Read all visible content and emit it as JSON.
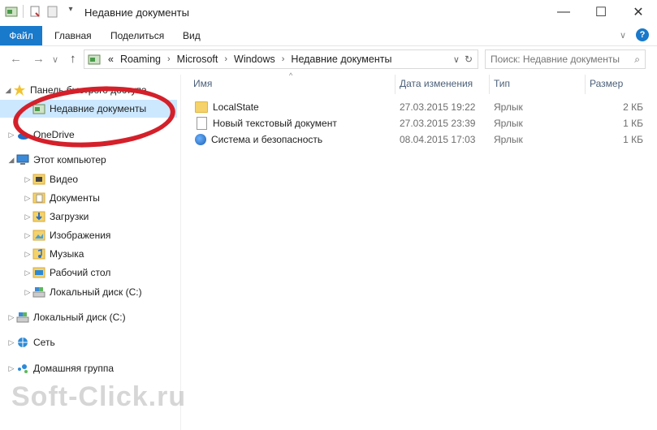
{
  "window": {
    "title": "Недавние документы",
    "minimize_glyph": "—",
    "maximize_glyph": "☐",
    "close_glyph": "✕"
  },
  "ribbon": {
    "file": "Файл",
    "home": "Главная",
    "share": "Поделиться",
    "view": "Вид",
    "expand_glyph": "∨",
    "help_glyph": "?"
  },
  "nav": {
    "back": "←",
    "forward": "→",
    "recent": "∨",
    "up": "↑",
    "breadcrumb": [
      "«",
      "Roaming",
      "Microsoft",
      "Windows",
      "Недавние документы"
    ],
    "separator": "›",
    "dropdown": "∨",
    "refresh": "↻",
    "search_placeholder": "Поиск: Недавние документы",
    "search_glyph": "⌕"
  },
  "navpane": {
    "quick_access": "Панель быстрого доступа",
    "recent_docs": "Недавние документы",
    "onedrive": "OneDrive",
    "this_pc": "Этот компьютер",
    "video": "Видео",
    "documents": "Документы",
    "downloads": "Загрузки",
    "pictures": "Изображения",
    "music": "Музыка",
    "desktop": "Рабочий стол",
    "local_disk_c": "Локальный диск (C:)",
    "local_disk_c2": "Локальный диск (C:)",
    "network": "Сеть",
    "homegroup": "Домашняя группа"
  },
  "columns": {
    "name": "Имя",
    "date": "Дата изменения",
    "type": "Тип",
    "size": "Размер",
    "sort_glyph": "^"
  },
  "files": [
    {
      "name": "LocalState",
      "date": "27.03.2015 19:22",
      "type": "Ярлык",
      "size": "2 КБ",
      "icon": "folder-icon"
    },
    {
      "name": "Новый текстовый документ",
      "date": "27.03.2015 23:39",
      "type": "Ярлык",
      "size": "1 КБ",
      "icon": "document-icon"
    },
    {
      "name": "Система и безопасность",
      "date": "08.04.2015 17:03",
      "type": "Ярлык",
      "size": "1 КБ",
      "icon": "control-panel-icon"
    }
  ],
  "watermark": "Soft-Click.ru",
  "colors": {
    "accent": "#1979ca",
    "selection": "#cce8ff",
    "annotation": "#d4202a"
  }
}
